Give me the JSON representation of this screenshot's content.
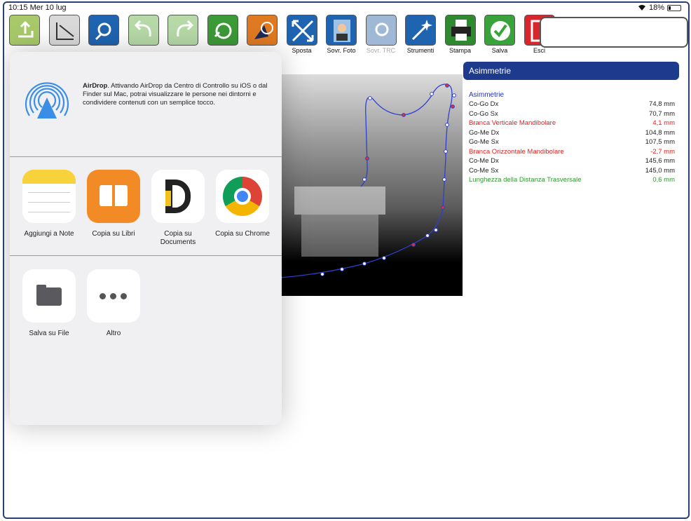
{
  "status": {
    "time": "10:15 Mer 10 lug",
    "battery": "18%"
  },
  "toolbar": [
    {
      "label": "",
      "icon": "export-icon",
      "color": "#a8c96a",
      "dim": false
    },
    {
      "label": "",
      "icon": "calibrate-icon",
      "color": "#d9d9d9",
      "dim": false
    },
    {
      "label": "",
      "icon": "lasso-icon",
      "color": "#1f64b0",
      "dim": false
    },
    {
      "label": "",
      "icon": "undo-icon",
      "color": "#b6d9a7",
      "dim": false
    },
    {
      "label": "",
      "icon": "redo-icon",
      "color": "#b6d9a7",
      "dim": false
    },
    {
      "label": "",
      "icon": "rotate-icon",
      "color": "#3c9a37",
      "dim": false
    },
    {
      "label": "",
      "icon": "cursor-icon",
      "color": "#e07a22",
      "dim": false
    },
    {
      "label": "Sposta",
      "icon": "move-icon",
      "color": "#1f64b0",
      "dim": false
    },
    {
      "label": "Sovr. Foto",
      "icon": "photo-overlay-icon",
      "color": "#1f64b0",
      "dim": false
    },
    {
      "label": "Sovr. TRC",
      "icon": "trc-overlay-icon",
      "color": "#9fb8d6",
      "dim": true
    },
    {
      "label": "Strumenti",
      "icon": "tools-icon",
      "color": "#1f64b0",
      "dim": false
    },
    {
      "label": "Stampa",
      "icon": "print-icon",
      "color": "#2f8a2f",
      "dim": false
    },
    {
      "label": "Salva",
      "icon": "save-icon",
      "color": "#3aa23a",
      "dim": false
    },
    {
      "label": "Esci",
      "icon": "exit-icon",
      "color": "#d8262c",
      "dim": false
    }
  ],
  "panel": {
    "header": "Asimmetrie",
    "section": "Asimmetrie",
    "rows": [
      {
        "name": "Co-Go Dx",
        "value": "74,8 mm",
        "color": "#222222"
      },
      {
        "name": "Co-Go Sx",
        "value": "70,7 mm",
        "color": "#222222"
      },
      {
        "name": "Branca Verticale Mandibolare",
        "value": "4,1 mm",
        "color": "#e02020"
      },
      {
        "name": "Go-Me Dx",
        "value": "104,8 mm",
        "color": "#222222"
      },
      {
        "name": "Go-Me Sx",
        "value": "107,5 mm",
        "color": "#222222"
      },
      {
        "name": "Branca Orizzontale Mandibolare",
        "value": "-2,7 mm",
        "color": "#e02020"
      },
      {
        "name": "Co-Me Dx",
        "value": "145,6 mm",
        "color": "#222222"
      },
      {
        "name": "Co-Me Sx",
        "value": "145,0 mm",
        "color": "#222222"
      },
      {
        "name": "Lunghezza della Distanza Trasversale",
        "value": "0,6 mm",
        "color": "#2e9a2e"
      }
    ]
  },
  "share": {
    "airdrop_bold": "AirDrop",
    "airdrop_text": ". Attivando AirDrop da Centro di Controllo su iOS o dal Finder sul Mac, potrai visualizzare le persone nei dintorni e condividere contenuti con un semplice tocco.",
    "apps": [
      {
        "label": "Aggiungi a Note",
        "icon": "notes-icon"
      },
      {
        "label": "Copia su Libri",
        "icon": "books-icon"
      },
      {
        "label": "Copia su Documents",
        "icon": "documents-icon"
      },
      {
        "label": "Copia su Chrome",
        "icon": "chrome-icon"
      }
    ],
    "actions": [
      {
        "label": "Salva su File",
        "icon": "folder-icon"
      },
      {
        "label": "Altro",
        "icon": "more-icon"
      }
    ]
  }
}
